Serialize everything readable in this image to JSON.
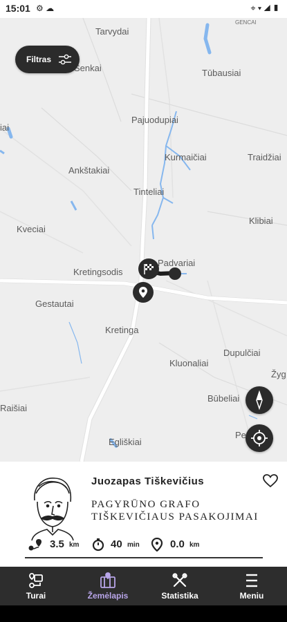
{
  "status_bar": {
    "time": "15:01"
  },
  "map": {
    "places": [
      {
        "id": "tarvydai",
        "label": "Tarvydai"
      },
      {
        "id": "gencai",
        "label": "GENCAI"
      },
      {
        "id": "senkai",
        "label": "Senkai"
      },
      {
        "id": "tubausiai",
        "label": "Tūbausiai"
      },
      {
        "id": "pajuodupiai",
        "label": "Pajuodupiai"
      },
      {
        "id": "iai",
        "label": "iai"
      },
      {
        "id": "kurmaiciai",
        "label": "Kurmaičiai"
      },
      {
        "id": "traidziai",
        "label": "Traidžiai"
      },
      {
        "id": "ankstakiai",
        "label": "Ankštakiai"
      },
      {
        "id": "tinteliai",
        "label": "Tinteliai"
      },
      {
        "id": "klibiai",
        "label": "Klibiai"
      },
      {
        "id": "kveciai",
        "label": "Kveciai"
      },
      {
        "id": "padvariai",
        "label": "Padvariai"
      },
      {
        "id": "kretingsodis",
        "label": "Kretingsodis"
      },
      {
        "id": "gestautai",
        "label": "Gestautai"
      },
      {
        "id": "kretinga",
        "label": "Kretinga"
      },
      {
        "id": "dupulciai",
        "label": "Dupulčiai"
      },
      {
        "id": "kluonaliai",
        "label": "Kluonaliai"
      },
      {
        "id": "zyg",
        "label": "Žyg"
      },
      {
        "id": "bubeliai",
        "label": "Būbeliai"
      },
      {
        "id": "raisiai",
        "label": "Raišiai"
      },
      {
        "id": "pe",
        "label": "Pe"
      },
      {
        "id": "egliskiai",
        "label": "Egliškiai"
      }
    ],
    "filter_label": "Filtras"
  },
  "tour": {
    "person": "Juozapas Tiškevičius",
    "title_lines": [
      "PAGYRŪNO GRAFO",
      "TIŠKEVIČIAUS PASAKOJIMAI"
    ],
    "distance": "3.5",
    "distance_unit": "km",
    "duration": "40",
    "duration_unit": "min",
    "to_start": "0.0",
    "to_start_unit": "km"
  },
  "nav": {
    "items": [
      {
        "id": "turai",
        "label": "Turai",
        "icon": "tours-icon",
        "active": false
      },
      {
        "id": "zemelapis",
        "label": "Žemėlapis",
        "icon": "map-icon",
        "active": true
      },
      {
        "id": "statistika",
        "label": "Statistika",
        "icon": "tools-icon",
        "active": false
      },
      {
        "id": "meniu",
        "label": "Meniu",
        "icon": "menu-icon",
        "active": false
      }
    ]
  },
  "colors": {
    "map_bg": "#eeeeee",
    "water": "#86b7ee",
    "road": "#ffffff",
    "dark": "#2b2b2b",
    "active_nav": "#b9a6ea",
    "nav_bg": "#2d2d2d"
  }
}
